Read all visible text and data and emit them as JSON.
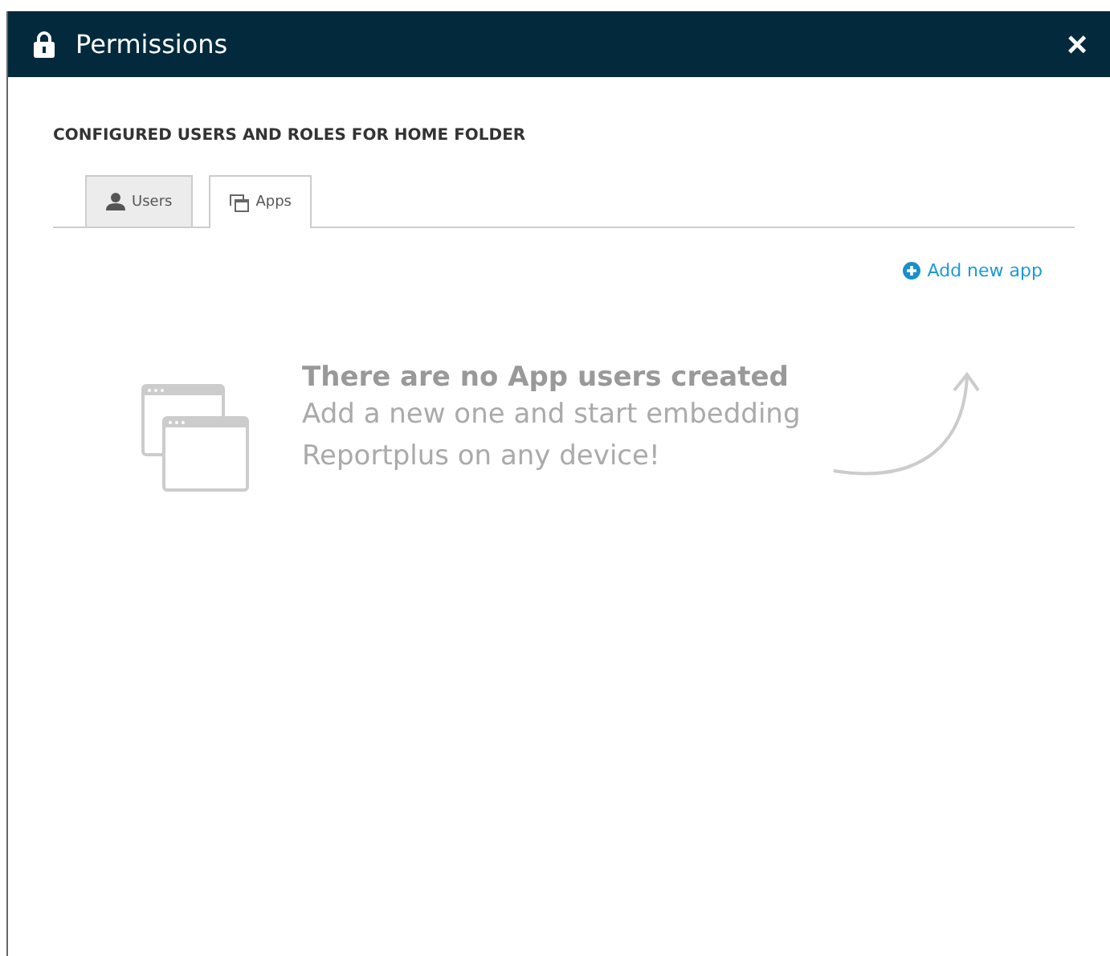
{
  "window": {
    "title": "Permissions",
    "close": "×"
  },
  "heading": "CONFIGURED USERS AND ROLES FOR HOME FOLDER",
  "tabs": [
    {
      "label": "Users",
      "kind": "users",
      "selected": false
    },
    {
      "label": "Apps",
      "kind": "apps",
      "selected": true
    }
  ],
  "add_link": "Add new app",
  "empty_state": {
    "title": "There are no App users created",
    "message": "Add a new one and start embedding Reportplus on any device!"
  }
}
